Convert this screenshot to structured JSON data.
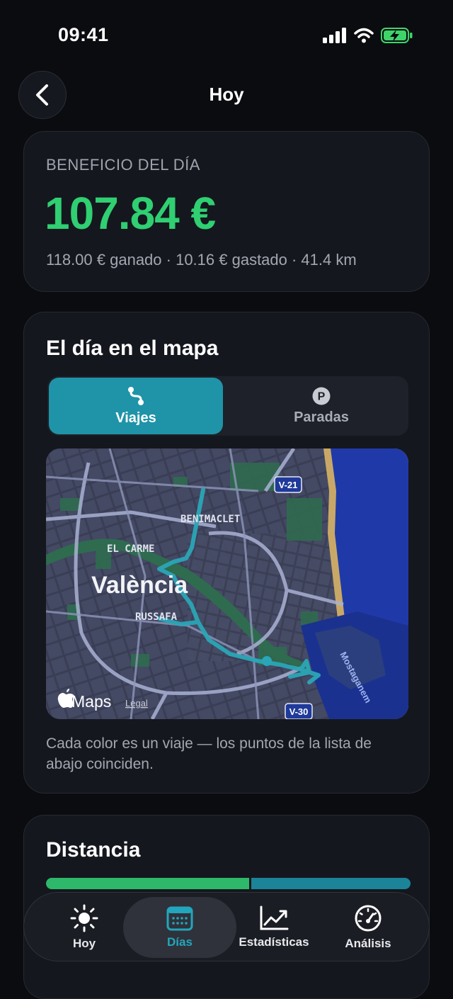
{
  "status_bar": {
    "time": "09:41"
  },
  "header": {
    "title": "Hoy"
  },
  "profit": {
    "label": "BENEFICIO DEL DÍA",
    "value": "107.84 €",
    "summary": "118.00 € ganado · 10.16 € gastado · 41.4 km"
  },
  "map_card": {
    "title": "El día en el mapa",
    "tabs": [
      {
        "label": "Viajes",
        "icon": "route-icon",
        "selected": true
      },
      {
        "label": "Paradas",
        "icon": "parking-icon",
        "selected": false
      }
    ],
    "map": {
      "city": "València",
      "neighborhoods": [
        "BENIMACLET",
        "EL CARME",
        "RUSSAFA"
      ],
      "road_badges": [
        "V-21",
        "V-30"
      ],
      "street": "Mostaganem",
      "attribution": "Maps",
      "legal": "Legal"
    },
    "caption": "Cada color es un viaje — los puntos de la lista de abajo coinciden."
  },
  "distance_card": {
    "title": "Distancia",
    "bar_fractions": [
      0.56,
      0.44
    ],
    "colors": [
      "#2db86a",
      "#1c8498"
    ]
  },
  "tab_bar": {
    "items": [
      {
        "label": "Hoy",
        "icon": "sun-icon"
      },
      {
        "label": "Días",
        "icon": "calendar-icon",
        "active": true
      },
      {
        "label": "Estadísticas",
        "icon": "chart-line-icon"
      },
      {
        "label": "Análisis",
        "icon": "gauge-icon"
      }
    ]
  },
  "colors": {
    "accent": "#1f94a8",
    "profit_green": "#2fcf72",
    "active_tab": "#22a6bd"
  }
}
